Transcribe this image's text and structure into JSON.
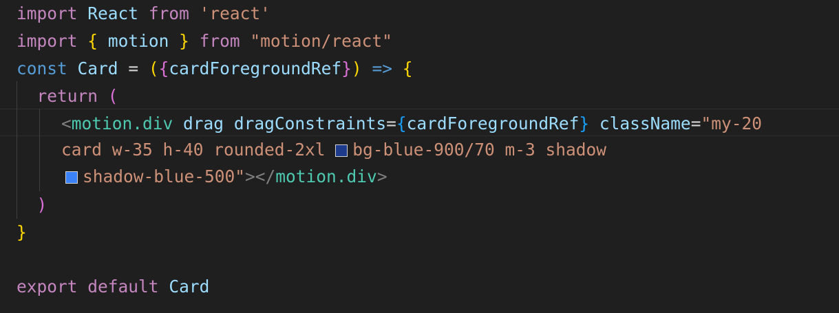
{
  "code": {
    "l1": {
      "kw1": "import",
      "name": "React",
      "kw2": "from",
      "src": "'react'"
    },
    "l2": {
      "kw1": "import",
      "ob": "{",
      "name": "motion",
      "cb": "}",
      "kw2": "from",
      "src": "\"motion/react\""
    },
    "l3": {
      "kw": "const",
      "name": "Card",
      "eq": "=",
      "op": "(",
      "ob": "{",
      "param": "cardForegroundRef",
      "cb": "}",
      "cp": ")",
      "arrow": "=>",
      "brace": "{"
    },
    "l4": {
      "kw": "return",
      "paren": "("
    },
    "l5": {
      "lt": "<",
      "tag": "motion.div",
      "attr1": "drag",
      "attr2": "dragConstraints",
      "eq": "=",
      "ob": "{",
      "val": "cardForegroundRef",
      "cb": "}",
      "attr3": "className",
      "eq2": "=",
      "str": "\"my-20"
    },
    "l6": {
      "str1": "card w-35 h-40 rounded-2xl",
      "str2": "bg-blue-900/70 m-3 shadow"
    },
    "l7": {
      "str": "shadow-blue-500\"",
      "gt": ">",
      "close_lt": "</",
      "tag": "motion.div",
      "close_gt": ">"
    },
    "l8": {
      "paren": ")"
    },
    "l9": {
      "brace": "}"
    },
    "l11": {
      "kw1": "export",
      "kw2": "default",
      "name": "Card"
    }
  },
  "swatches": {
    "bg_blue_900_70": "#1e3a8a",
    "shadow_blue_500": "#3b82f6"
  }
}
